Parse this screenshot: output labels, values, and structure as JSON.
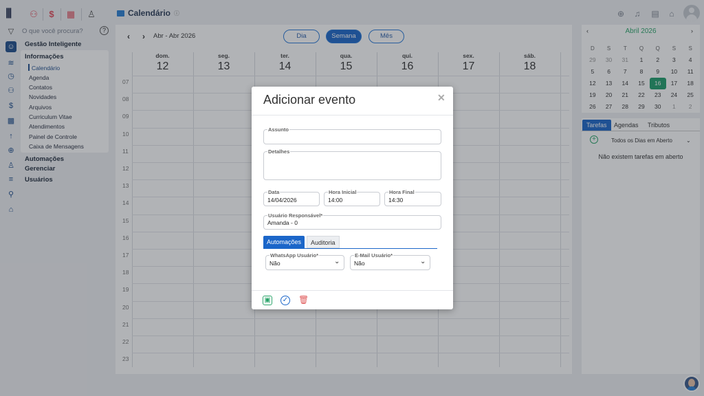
{
  "topbar": {
    "page_title": "Calendário",
    "info_glyph": "ⓘ"
  },
  "sidebar": {
    "search_placeholder": "O que você procura?",
    "help_glyph": "?",
    "section_main": "Gestão Inteligente",
    "section_info": "Informações",
    "items": [
      "Calendário",
      "Agenda",
      "Contatos",
      "Novidades",
      "Arquivos",
      "Curriculum Vitae",
      "Atendimentos",
      "Painel de Controle",
      "Caixa de Mensagens"
    ],
    "section_automacoes": "Automações",
    "section_gerenciar": "Gerenciar",
    "section_usuarios": "Usuários"
  },
  "calendar": {
    "prev_glyph": "‹",
    "next_glyph": "›",
    "range": "Abr - Abr 2026",
    "views": [
      "Dia",
      "Semana",
      "Mês"
    ],
    "active_view": "Semana",
    "days": [
      {
        "name": "dom.",
        "num": "12"
      },
      {
        "name": "seg.",
        "num": "13"
      },
      {
        "name": "ter.",
        "num": "14"
      },
      {
        "name": "qua.",
        "num": "15"
      },
      {
        "name": "qui.",
        "num": "16"
      },
      {
        "name": "sex.",
        "num": "17"
      },
      {
        "name": "sáb.",
        "num": "18"
      }
    ],
    "hours": [
      "07",
      "08",
      "09",
      "10",
      "11",
      "12",
      "13",
      "14",
      "15",
      "16",
      "17",
      "18",
      "19",
      "20",
      "21",
      "22",
      "23"
    ]
  },
  "mini_calendar": {
    "title": "Abril 2026",
    "weekdays": [
      "D",
      "S",
      "T",
      "Q",
      "Q",
      "S",
      "S"
    ],
    "weeks": [
      [
        "29",
        "30",
        "31",
        "1",
        "2",
        "3",
        "4"
      ],
      [
        "5",
        "6",
        "7",
        "8",
        "9",
        "10",
        "11"
      ],
      [
        "12",
        "13",
        "14",
        "15",
        "16",
        "17",
        "18"
      ],
      [
        "19",
        "20",
        "21",
        "22",
        "23",
        "24",
        "25"
      ],
      [
        "26",
        "27",
        "28",
        "29",
        "30",
        "1",
        "2"
      ]
    ],
    "today": "16"
  },
  "tasks": {
    "tabs": [
      "Tarefas",
      "Agendas",
      "Tributos"
    ],
    "filter": "Todos os Dias em Aberto",
    "empty": "Não existem tarefas em aberto"
  },
  "modal": {
    "title": "Adicionar evento",
    "close_glyph": "✕",
    "assunto_label": "Assunto",
    "assunto_value": "",
    "detalhes_label": "Detalhes",
    "detalhes_value": "",
    "data_label": "Data",
    "data_value": "14/04/2026",
    "hora_inicial_label": "Hora Inicial",
    "hora_inicial_value": "14:00",
    "hora_final_label": "Hora Final",
    "hora_final_value": "14:30",
    "usuario_label": "Usuário Responsável*",
    "usuario_value": "Amanda - 0",
    "tabs": [
      "Automações",
      "Auditoria"
    ],
    "whatsapp_label": "WhatsApp Usuário*",
    "whatsapp_value": "Não",
    "email_label": "E-Mail Usuário*",
    "email_value": "Não"
  },
  "colors": {
    "accent_blue": "#1b66c9",
    "today_green": "#1f9d6b",
    "save_green": "#2aa46a",
    "delete_red": "#e05a5a"
  }
}
